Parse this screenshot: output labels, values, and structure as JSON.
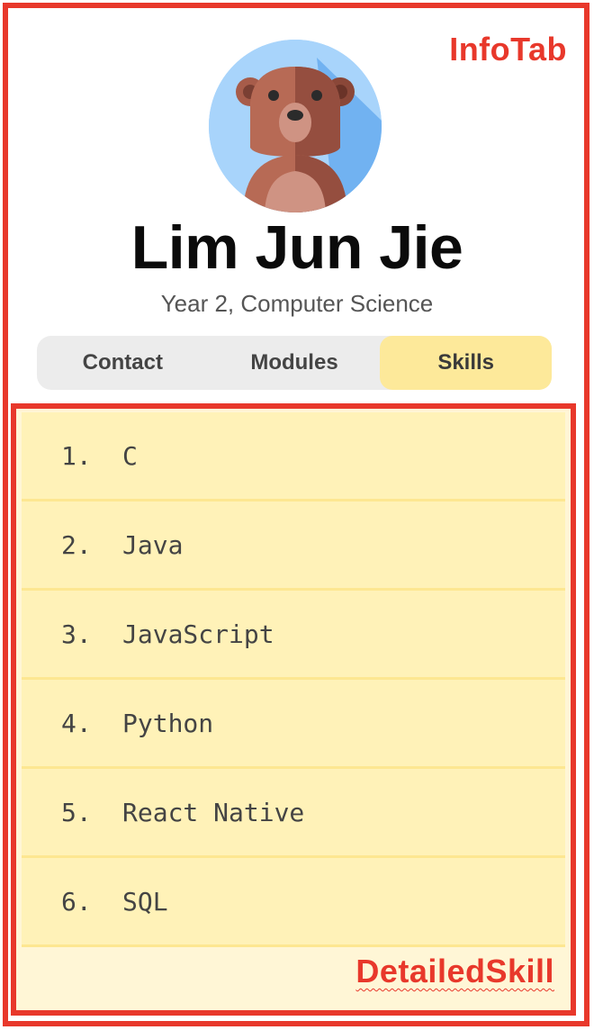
{
  "annotations": {
    "info_tab": "InfoTab",
    "detailed_skill": "DetailedSkill"
  },
  "profile": {
    "name": "Lim Jun Jie",
    "subtitle": "Year 2, Computer Science"
  },
  "tabs": [
    {
      "label": "Contact",
      "active": false
    },
    {
      "label": "Modules",
      "active": false
    },
    {
      "label": "Skills",
      "active": true
    }
  ],
  "skills": [
    {
      "number": "1.",
      "name": "C"
    },
    {
      "number": "2.",
      "name": "Java"
    },
    {
      "number": "3.",
      "name": "JavaScript"
    },
    {
      "number": "4.",
      "name": "Python"
    },
    {
      "number": "5.",
      "name": "React Native"
    },
    {
      "number": "6.",
      "name": "SQL"
    }
  ],
  "colors": {
    "annotation_red": "#e8382b",
    "active_tab": "#fde99a",
    "skill_row": "#fff2b8"
  }
}
